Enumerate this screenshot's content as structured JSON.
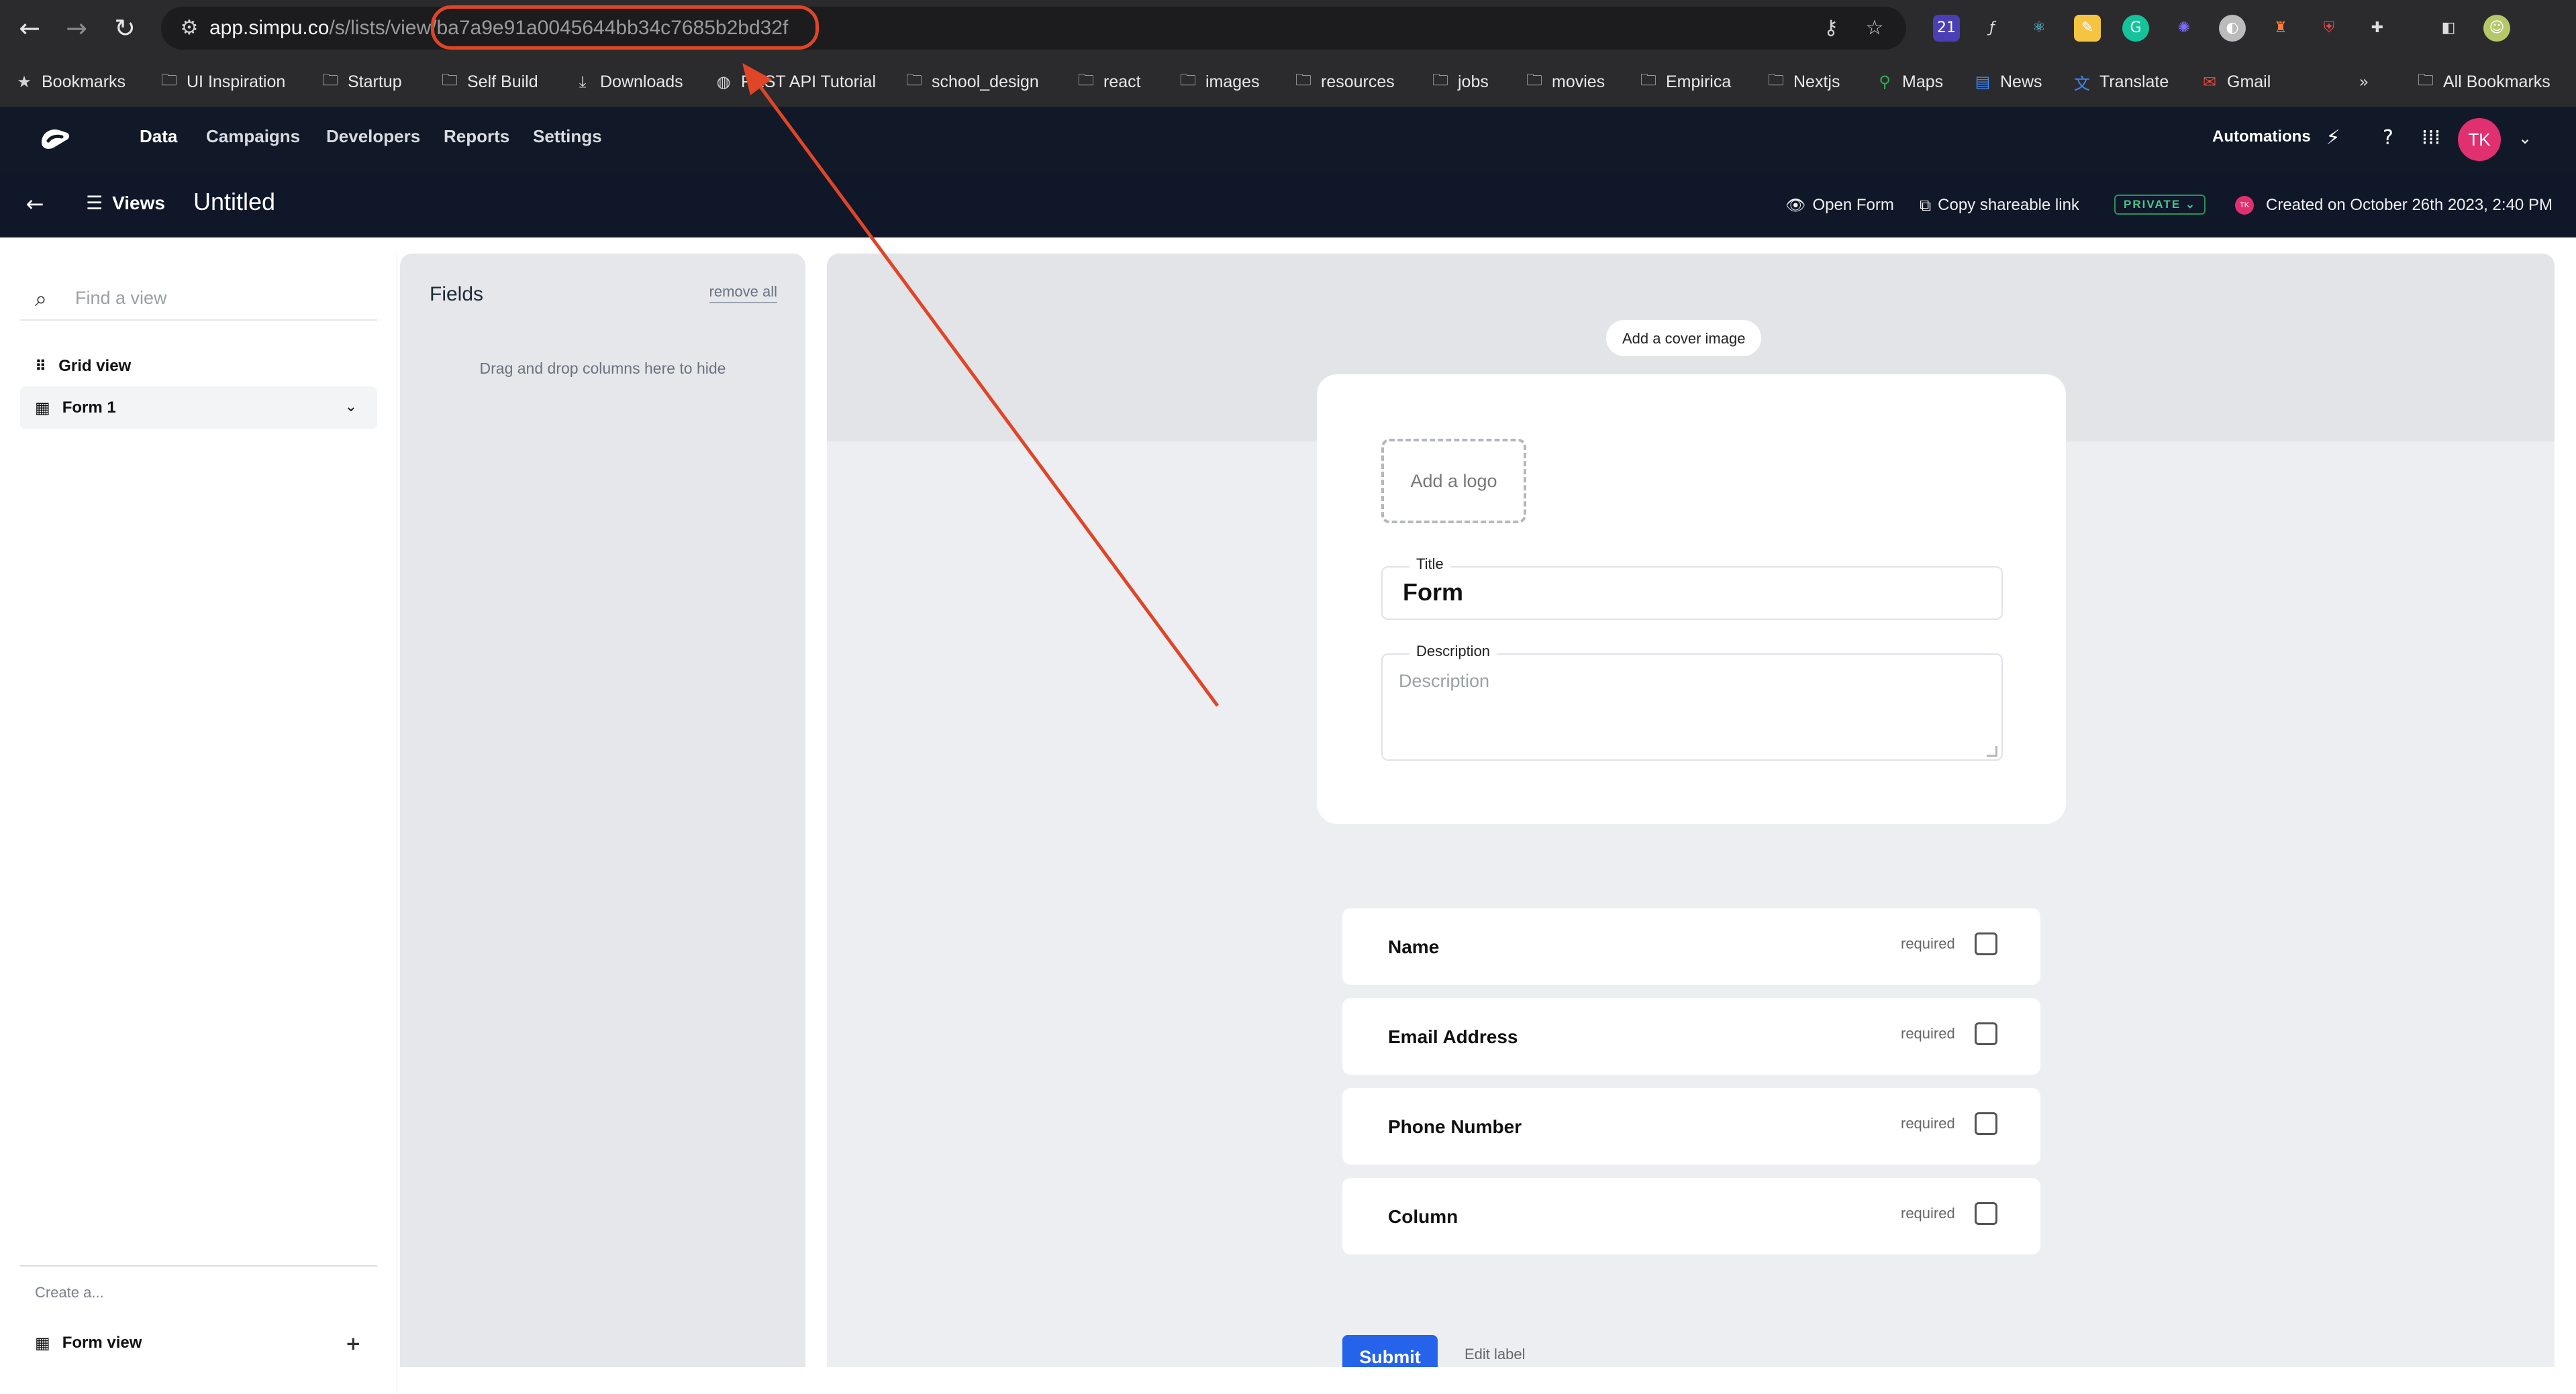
{
  "browser": {
    "url_host": "app.simpu.co",
    "url_path": "/s/lists/view/",
    "url_id": "ba7a9e91a0045644bb34c7685b2bd32f",
    "extension_badge": "21",
    "bookmarks": [
      "Bookmarks",
      "UI Inspiration",
      "Startup",
      "Self Build",
      "Downloads",
      "REST API Tutorial",
      "school_design",
      "react",
      "images",
      "resources",
      "jobs",
      "movies",
      "Empirica",
      "Nextjs",
      "Maps",
      "News",
      "Translate",
      "Gmail"
    ],
    "all_bookmarks": "All Bookmarks"
  },
  "header": {
    "nav": [
      "Data",
      "Campaigns",
      "Developers",
      "Reports",
      "Settings"
    ],
    "automations": "Automations",
    "avatar_initials": "TK"
  },
  "subheader": {
    "views_label": "Views",
    "title": "Untitled",
    "open_form": "Open Form",
    "copy_link": "Copy shareable link",
    "privacy_badge": "PRIVATE",
    "created": "Created on October 26th 2023, 2:40 PM",
    "tiny_avatar": "TK"
  },
  "views_panel": {
    "search_placeholder": "Find a view",
    "items": [
      "Grid view",
      "Form 1"
    ],
    "create_label": "Create a...",
    "create_item": "Form view"
  },
  "fields_panel": {
    "title": "Fields",
    "remove_all": "remove all",
    "hint": "Drag and drop columns here to hide"
  },
  "form": {
    "cover_button": "Add a cover image",
    "logo_placeholder": "Add a logo",
    "title_label": "Title",
    "title_value": "Form",
    "description_label": "Description",
    "description_placeholder": "Description",
    "fields": [
      "Name",
      "Email Address",
      "Phone Number",
      "Column"
    ],
    "required_label": "required",
    "submit": "Submit",
    "edit_label": "Edit label"
  },
  "colors": {
    "accent": "#2563eb",
    "annotation": "#e04528",
    "avatar": "#e0306f",
    "header_bg": "#111827"
  }
}
